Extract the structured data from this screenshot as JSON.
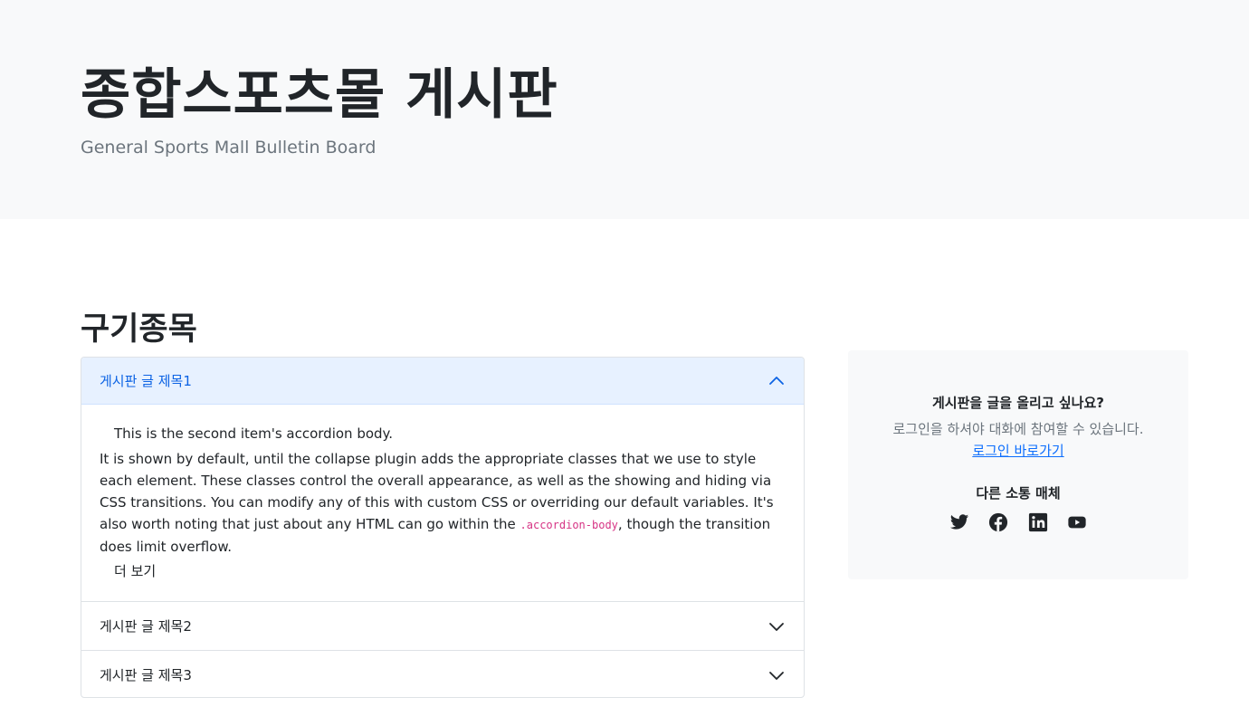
{
  "hero": {
    "title": "종합스포츠몰 게시판",
    "subtitle": "General Sports Mall Bulletin Board"
  },
  "main": {
    "section_title": "구기종목",
    "accordion": [
      {
        "title": "게시판 글 제목1",
        "expanded": true,
        "body_lead": "This is the second item's accordion body.",
        "body_text_before_code": "It is shown by default, until the collapse plugin adds the appropriate classes that we use to style each element. These classes control the overall appearance, as well as the showing and hiding via CSS transitions. You can modify any of this with custom CSS or overriding our default variables. It's also worth noting that just about any HTML can go within the ",
        "body_code": ".accordion-body",
        "body_text_after_code": ", though the transition does limit overflow.",
        "more_label": "더 보기"
      },
      {
        "title": "게시판 글 제목2",
        "expanded": false
      },
      {
        "title": "게시판 글 제목3",
        "expanded": false
      }
    ]
  },
  "sidebar": {
    "question": "게시판을 글을 올리고 싶나요?",
    "info": "로그인을 하셔야 대화에 참여할 수 있습니다.",
    "login_link": "로그인 바로가기",
    "social_title": "다른 소통 매체",
    "social_icons": [
      "twitter-icon",
      "facebook-icon",
      "linkedin-icon",
      "youtube-icon"
    ]
  },
  "colors": {
    "hero_bg": "#f8f9fa",
    "accordion_active_bg": "#e7f1ff",
    "accordion_active_text": "#0c63e4",
    "link": "#0d6efd",
    "muted": "#6c757d",
    "code": "#d63384"
  }
}
